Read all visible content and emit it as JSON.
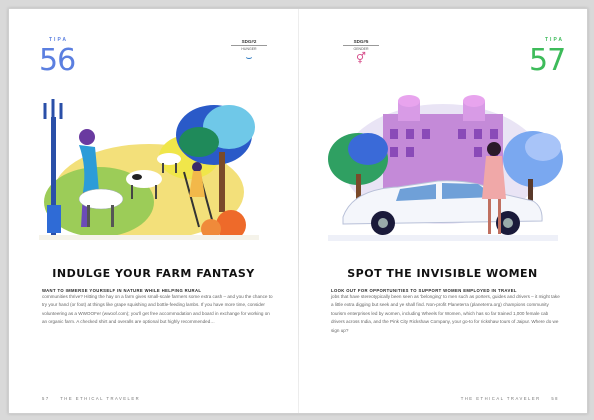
{
  "left": {
    "tip_label": "TIPA",
    "tip_number": "56",
    "sdg_label": "SDG#2",
    "sdg_value": "HUNGER",
    "sdg_icon": "bowl-icon",
    "title": "INDULGE YOUR FARM FANTASY",
    "subtitle": "WANT TO IMMERSE YOURSELF IN NATURE WHILE HELPING RURAL",
    "body": "communities thrive? Hitting the hay on a farm gives small-scale farmers some extra cash – and you the chance to try your hand (or foot) at things like grape squishing and bottle-feeding lambs. If you have more time, consider volunteering as a WWOOFer (wwoof.com); you'll get free accommodation and board in exchange for working on an organic farm. A checked shirt and overalls are optional but highly recommended…",
    "page_number": "57",
    "running_title": "THE ETHICAL TRAVELER"
  },
  "right": {
    "tip_label": "TIPA",
    "tip_number": "57",
    "sdg_label": "SDG#5",
    "sdg_value": "GENDER",
    "sdg_icon": "gender-symbol-icon",
    "title": "SPOT THE INVISIBLE WOMEN",
    "subtitle": "LOOK OUT FOR OPPORTUNITIES TO SUPPORT WOMEN EMPLOYED IN TRAVEL",
    "body": "jobs that have stereotypically been seen as 'belonging' to men such as porters, guides and drivers – it might take a little extra digging but seek and ye shall find. Non-profit Planeterra (planeterra.org) champions community tourism enterprises led by women, including Wheels for Women, which has so far trained 1,000 female cab drivers across India, and the Pink City Rickshaw Company, your go-to for rickshaw tours of Jaipur. Where do we sign up?",
    "page_number": "58",
    "running_title": "THE ETHICAL TRAVELER"
  },
  "colors": {
    "tip_left": "#5b7fe0",
    "tip_right": "#3dbb5a",
    "sdg_left": "#3b82c4",
    "sdg_right": "#d64d8a"
  }
}
